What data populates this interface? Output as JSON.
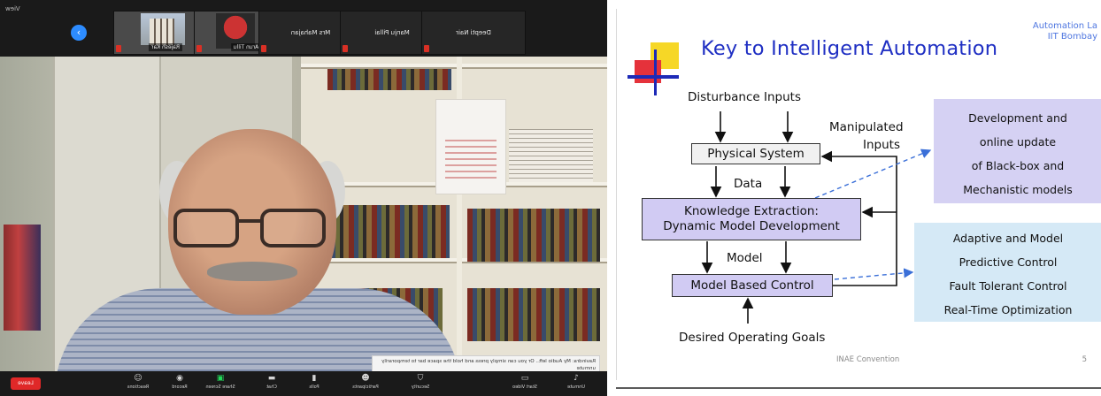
{
  "call": {
    "top_strip": {
      "view_label": "View",
      "participants": [
        {
          "name": "Deepti Nair"
        },
        {
          "name": "Manju Pillai"
        },
        {
          "name": "Mrs Mahajan"
        },
        {
          "name": "Arun Tillu"
        },
        {
          "name": "Rajesh Kar"
        }
      ]
    },
    "chat_preview": "Ravindra: My Audio left.. Or you can simply press and hold the space bar to temporarily unmute",
    "toolbar": {
      "leave_label": "Leave",
      "items": [
        "Unmute",
        "Start Video",
        "Security",
        "Participants",
        "Polls",
        "Chat",
        "Share Screen",
        "Record",
        "Reactions"
      ],
      "participant_count": "128"
    }
  },
  "slide": {
    "title": "Key to Intelligent Automation",
    "institution_line1": "Automation La",
    "institution_line2": "IIT Bombay",
    "labels": {
      "disturbance": "Disturbance Inputs",
      "manipulated_1": "Manipulated",
      "manipulated_2": "Inputs",
      "data": "Data",
      "model": "Model",
      "goals": "Desired Operating Goals"
    },
    "boxes": {
      "physical": "Physical System",
      "knowledge_1": "Knowledge Extraction:",
      "knowledge_2": "Dynamic Model Development",
      "control": "Model Based Control"
    },
    "panel_top": [
      "Development and",
      "online update",
      "of Black-box and",
      "Mechanistic models"
    ],
    "panel_bottom": [
      "Adaptive and Model",
      "Predictive Control",
      "Fault Tolerant Control",
      "Real-Time Optimization"
    ],
    "footer": "INAE Convention",
    "page_number": "5",
    "colors": {
      "title": "#1f2fc3",
      "box_fill": "#d1cbf3",
      "panel_blue": "#d5e9f6",
      "dashed_arrow": "#3a6fd8"
    }
  }
}
